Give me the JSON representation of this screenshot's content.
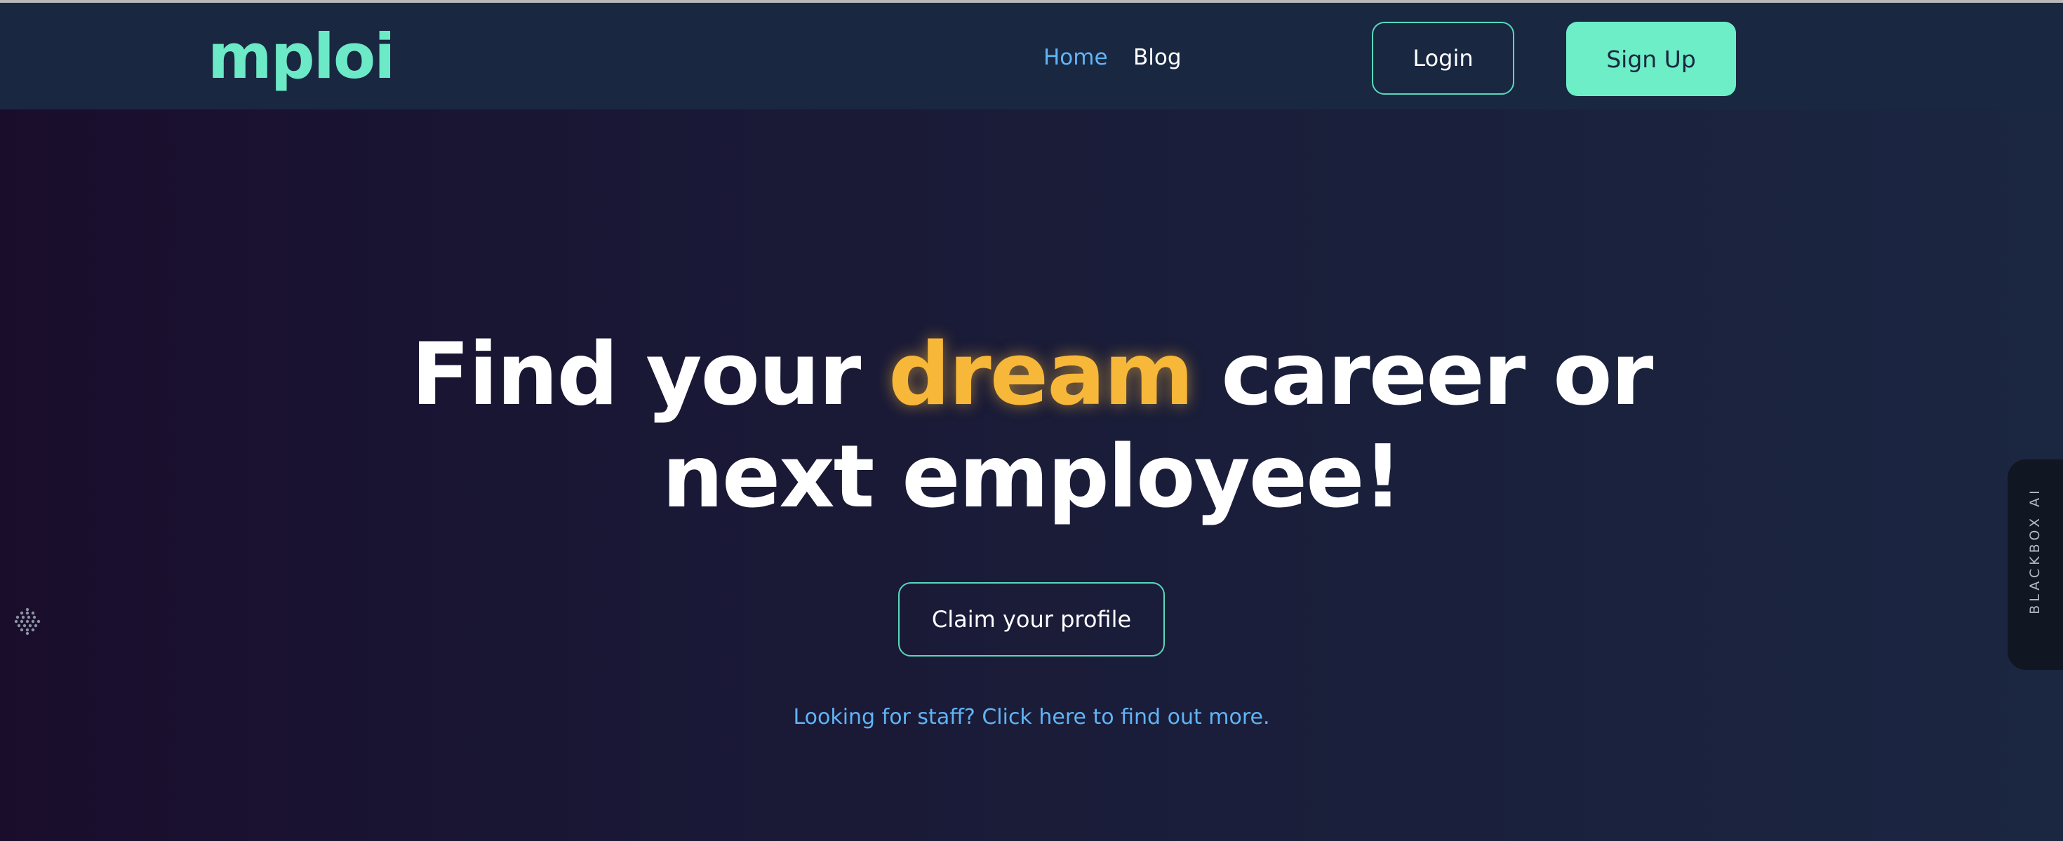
{
  "brand": {
    "logo_text": "mploi",
    "color": "#6ce9c6"
  },
  "nav": {
    "items": [
      {
        "label": "Home",
        "active": true
      },
      {
        "label": "Blog",
        "active": false
      }
    ],
    "login_label": "Login",
    "signup_label": "Sign Up"
  },
  "hero": {
    "title_part1": "Find your ",
    "title_accent": "dream",
    "title_part2": " career or next employee!",
    "claim_label": "Claim your profile",
    "staff_link": "Looking for staff? Click here to find out more."
  },
  "widget": {
    "label": "BLACKBOX AI",
    "icon": "blackbox-dots-icon"
  },
  "colors": {
    "nav_bg": "#192741",
    "accent_teal": "#6deec7",
    "accent_yellow": "#f7b738",
    "link_blue": "#60b4f6"
  }
}
